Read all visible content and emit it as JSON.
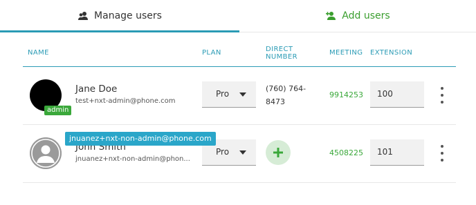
{
  "tabs": {
    "manage_label": "Manage users",
    "add_label": "Add users"
  },
  "columns": {
    "name": "NAME",
    "plan": "PLAN",
    "direct_line1": "DIRECT",
    "direct_line2": "NUMBER",
    "meeting": "MEETING",
    "extension": "EXTENSION"
  },
  "users": [
    {
      "name": "Jane Doe",
      "email": "test+nxt-admin@phone.com",
      "badge": "admin",
      "plan": "Pro",
      "direct_line1": "(760) 764-",
      "direct_line2": "8473",
      "meeting": "9914253",
      "extension": "100"
    },
    {
      "name": "John Smith",
      "email": "jnuanez+nxt-non-admin@phone.com",
      "email_display": "jnuanez+nxt-non-admin@phon...",
      "plan": "Pro",
      "meeting": "4508225",
      "extension": "101"
    }
  ],
  "tooltip": "jnuanez+nxt-non-admin@phone.com",
  "colors": {
    "accent_blue": "#2a9bb5",
    "accent_green": "#3aa83a",
    "tooltip_bg": "#2aa6c9"
  },
  "icons": {
    "manage_tab": "users-icon",
    "add_tab": "add-user-icon",
    "add_number": "plus-icon",
    "row_menu": "more-vertical-icon",
    "plan_dropdown": "caret-down-icon"
  }
}
